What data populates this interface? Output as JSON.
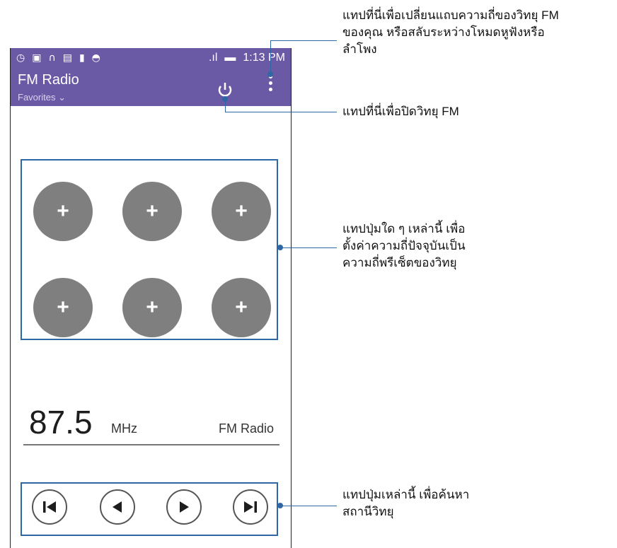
{
  "status_bar": {
    "time": "1:13 PM",
    "signal": ".ıl"
  },
  "app": {
    "title": "FM Radio",
    "favorites_label": "Favorites",
    "accent_color": "#6a5aa6"
  },
  "presets": [
    "+",
    "+",
    "+",
    "+",
    "+",
    "+"
  ],
  "tuner": {
    "frequency": "87.5",
    "unit": "MHz",
    "station_name": "FM Radio"
  },
  "annotations": {
    "menu": [
      "แทปที่นี่เพื่อเปลี่ยนแถบความถี่ของวิทยุ FM",
      "ของคุณ หรือสลับระหว่างโหมดหูฟังหรือ",
      "ลำโพง"
    ],
    "power": [
      "แทปที่นี่เพื่อปิดวิทยุ FM"
    ],
    "presets": [
      "แทปปุ่มใด ๆ เหล่านี้ เพื่อ",
      "ตั้งค่าความถี่ปัจจุบันเป็น",
      "ความถี่พรีเซ็ตของวิทยุ"
    ],
    "controls": [
      "แทปปุ่มเหล่านี้ เพื่อค้นหา",
      "สถานีวิทยุ"
    ]
  }
}
